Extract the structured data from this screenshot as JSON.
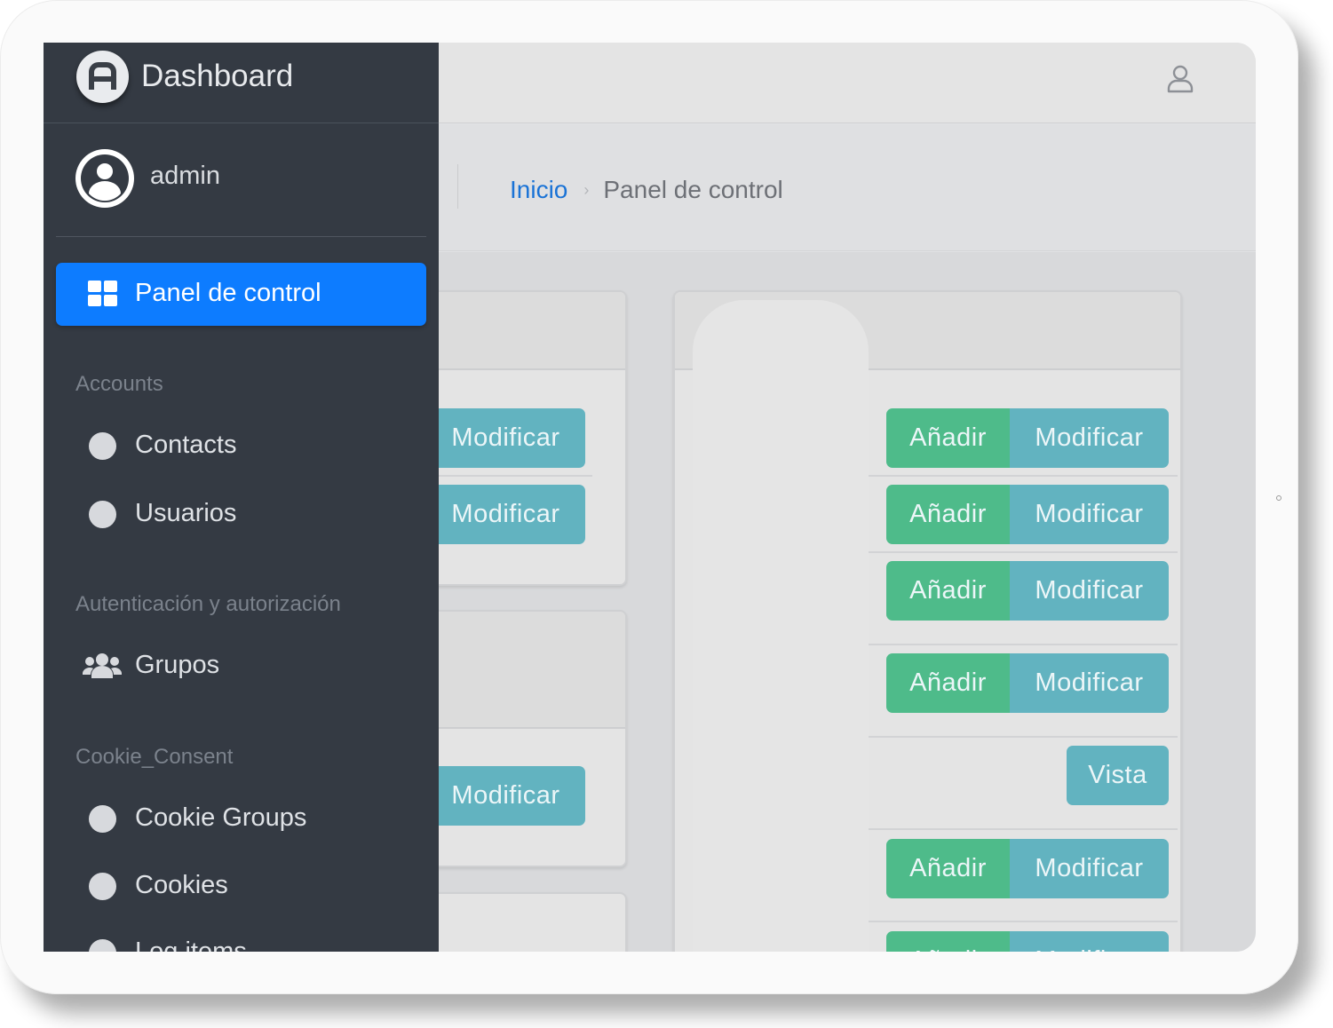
{
  "app": {
    "brand_title": "Dashboard",
    "user_name": "admin"
  },
  "topbar": {
    "user_icon": "user-outline-icon"
  },
  "breadcrumb": {
    "home": "Inicio",
    "separator": "›",
    "current": "Panel de control"
  },
  "sidebar": {
    "active_item": {
      "label": "Panel de control",
      "icon": "grid-icon"
    },
    "sections": [
      {
        "header": "Accounts",
        "items": [
          {
            "label": "Contacts",
            "icon": "circle-icon"
          },
          {
            "label": "Usuarios",
            "icon": "circle-icon"
          }
        ]
      },
      {
        "header": "Autenticación y autorización",
        "items": [
          {
            "label": "Grupos",
            "icon": "users-icon"
          }
        ]
      },
      {
        "header": "Cookie_Consent",
        "items": [
          {
            "label": "Cookie Groups",
            "icon": "circle-icon"
          },
          {
            "label": "Cookies",
            "icon": "circle-icon"
          },
          {
            "label": "Log items",
            "icon": "circle-icon"
          }
        ]
      }
    ]
  },
  "buttons": {
    "add": "Añadir",
    "modify": "Modificar",
    "view": "Vista"
  },
  "colors": {
    "sidebar_bg": "#343a43",
    "active_blue": "#0d7cff",
    "add_green": "#4ebb8a",
    "modify_teal": "#62b3c0",
    "link_blue": "#1a73d6"
  }
}
